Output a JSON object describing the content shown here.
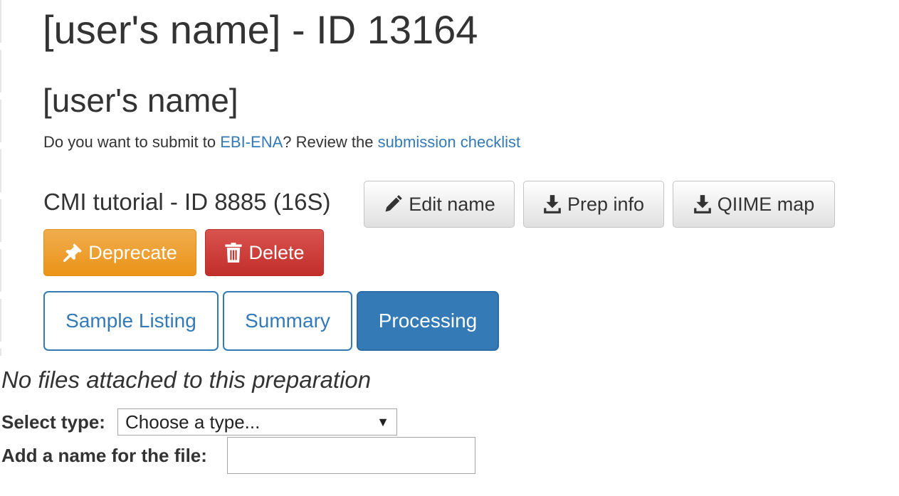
{
  "header": {
    "title": "[user's name] - ID 13164",
    "study_name": "[user's name]"
  },
  "ebi": {
    "prefix": "Do you want to submit to ",
    "link1": "EBI-ENA",
    "middle": "? Review the ",
    "link2": "submission checklist"
  },
  "prep": {
    "title": "CMI tutorial - ID 8885 (16S)",
    "buttons": {
      "edit_name": "Edit name",
      "prep_info": "Prep info",
      "qiime_map": "QIIME map",
      "deprecate": "Deprecate",
      "delete": "Delete"
    }
  },
  "tabs": [
    {
      "label": "Sample Listing",
      "active": false
    },
    {
      "label": "Summary",
      "active": false
    },
    {
      "label": "Processing",
      "active": true
    }
  ],
  "processing": {
    "no_files": "No files attached to this preparation",
    "select_type_label": "Select type:",
    "select_type_value": "Choose a type...",
    "file_name_label": "Add a name for the file:",
    "file_name_value": ""
  },
  "colors": {
    "link": "#337ab7",
    "warning": "#f0ad4e",
    "danger": "#d9534f",
    "primary": "#337ab7"
  },
  "icons": {
    "edit": "pencil-icon",
    "download": "download-icon",
    "deprecate": "pushpin-icon",
    "delete": "trash-icon",
    "select": "caret-down-icon"
  }
}
